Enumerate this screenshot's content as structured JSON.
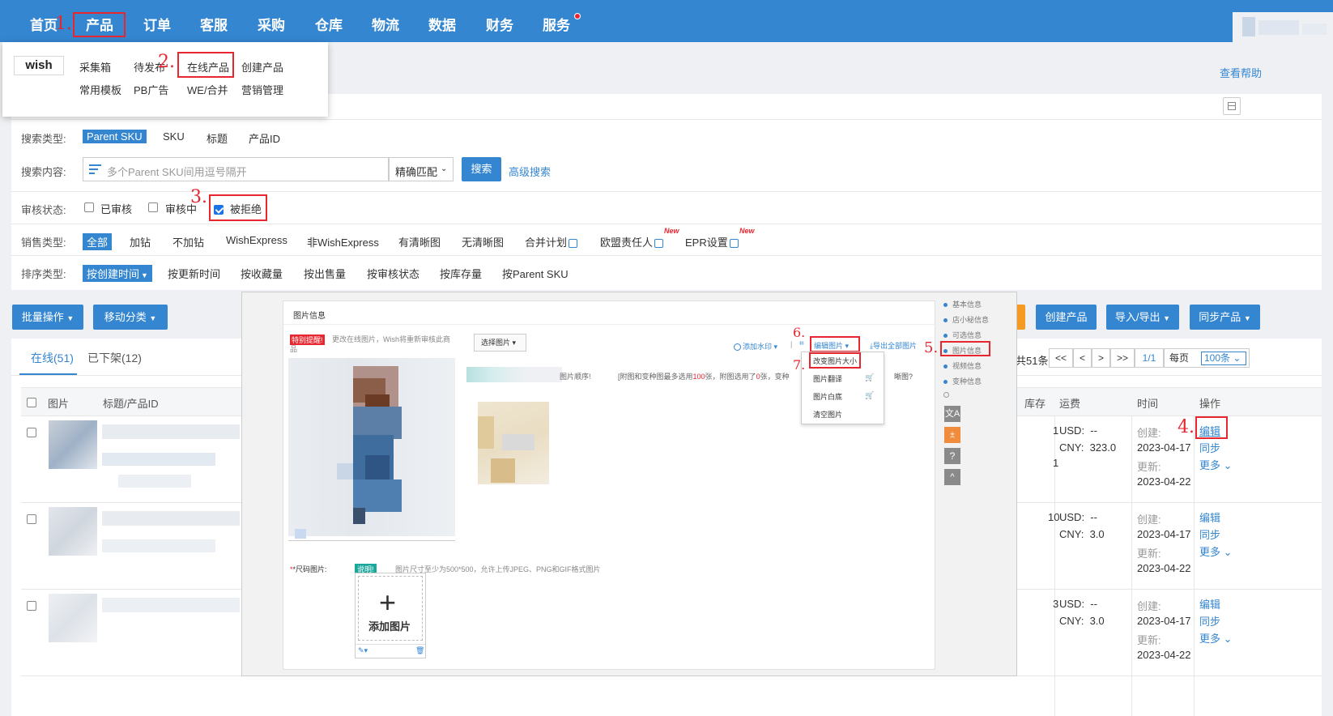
{
  "nav": {
    "items": [
      "首页",
      "产品",
      "订单",
      "客服",
      "采购",
      "仓库",
      "物流",
      "数据",
      "财务",
      "服务"
    ]
  },
  "help": "查看帮助",
  "product_menu": {
    "logo": "wish",
    "row1": [
      "采集箱",
      "待发布",
      "在线产品",
      "创建产品"
    ],
    "row2": [
      "常用模板",
      "PB广告",
      "WE/合并",
      "营销管理"
    ]
  },
  "steps": [
    "1.",
    "2.",
    "3.",
    "4.",
    "5.",
    "6.",
    "7."
  ],
  "filters": {
    "search_type": {
      "label": "搜索类型:",
      "options": [
        "Parent SKU",
        "SKU",
        "标题",
        "产品ID"
      ]
    },
    "search_content": {
      "label": "搜索内容:",
      "placeholder": "多个Parent SKU间用逗号隔开",
      "match": "精确匹配",
      "search_btn": "搜索",
      "advanced": "高级搜索"
    },
    "review": {
      "label": "审核状态:",
      "options": [
        "已审核",
        "审核中",
        "被拒绝"
      ]
    },
    "sales": {
      "label": "销售类型:",
      "options": [
        "全部",
        "加钻",
        "不加钻",
        "WishExpress",
        "非WishExpress",
        "有清晰图",
        "无清晰图",
        "合并计划",
        "欧盟责任人",
        "EPR设置"
      ],
      "new_tag": "New"
    },
    "sort": {
      "label": "排序类型:",
      "options": [
        "按创建时间",
        "按更新时间",
        "按收藏量",
        "按出售量",
        "按审核状态",
        "按库存量",
        "按Parent SKU"
      ]
    }
  },
  "toolbar": {
    "batch": "批量操作",
    "move": "移动分类",
    "create": "创建产品",
    "import_export": "导入/导出",
    "sync": "同步产品"
  },
  "tabs": {
    "online": "在线(51)",
    "offline": "已下架(12)"
  },
  "pager": {
    "total": "共51条",
    "first": "<<",
    "prev": "<",
    "next": ">",
    "last": ">>",
    "page": "1/1",
    "per_label": "每页",
    "per_value": "100条"
  },
  "table": {
    "headers": {
      "image": "图片",
      "title": "标题/产品ID",
      "stock": "库存",
      "shipping": "运费",
      "time": "时间",
      "ops": "操作"
    },
    "rows": [
      {
        "stock": "1",
        "stock2": "1",
        "usd": "USD:  --",
        "cny": "CNY:  323.0",
        "created_label": "创建:",
        "created": "2023-04-17",
        "updated_label": "更新:",
        "updated": "2023-04-22",
        "edit": "编辑",
        "sync": "同步",
        "more": "更多"
      },
      {
        "stock": "10",
        "usd": "USD:  --",
        "cny": "CNY:  3.0",
        "created_label": "创建:",
        "created": "2023-04-17",
        "updated_label": "更新:",
        "updated": "2023-04-22",
        "edit": "编辑",
        "sync": "同步",
        "more": "更多"
      },
      {
        "stock": "3",
        "usd": "USD:  --",
        "cny": "CNY:  3.0",
        "created_label": "创建:",
        "created": "2023-04-17",
        "updated_label": "更新:",
        "updated": "2023-04-22",
        "edit": "编辑",
        "sync": "同步",
        "more": "更多"
      }
    ]
  },
  "overlay": {
    "section_title": "图片信息",
    "warn_badge": "特别提醒!",
    "warn_text": "更改在线图片，Wish将重新审核此商品",
    "select_image": "选择图片",
    "add_watermark": "添加水印",
    "edit_image": "编辑图片",
    "export_all": "导出全部图片",
    "order_note": "图片顺序!",
    "count_note": "[附图和变种图最多选用",
    "count_num": "100",
    "count_note2": "张，附图选用了",
    "count_sel": "0",
    "count_note3": "张，变种",
    "blur_q": "晰图?",
    "edit_menu": [
      "改变图片大小",
      "图片翻译",
      "图片白底",
      "清空图片"
    ],
    "side_nav": [
      "基本信息",
      "店小秘信息",
      "可选信息",
      "图片信息",
      "视频信息",
      "变种信息"
    ],
    "size_label": "*尺码图片:",
    "note_badge": "说明!",
    "size_note": "图片尺寸至少为500*500，允许上传JPEG、PNG和GIF格式图片",
    "add_image": "添加图片"
  }
}
